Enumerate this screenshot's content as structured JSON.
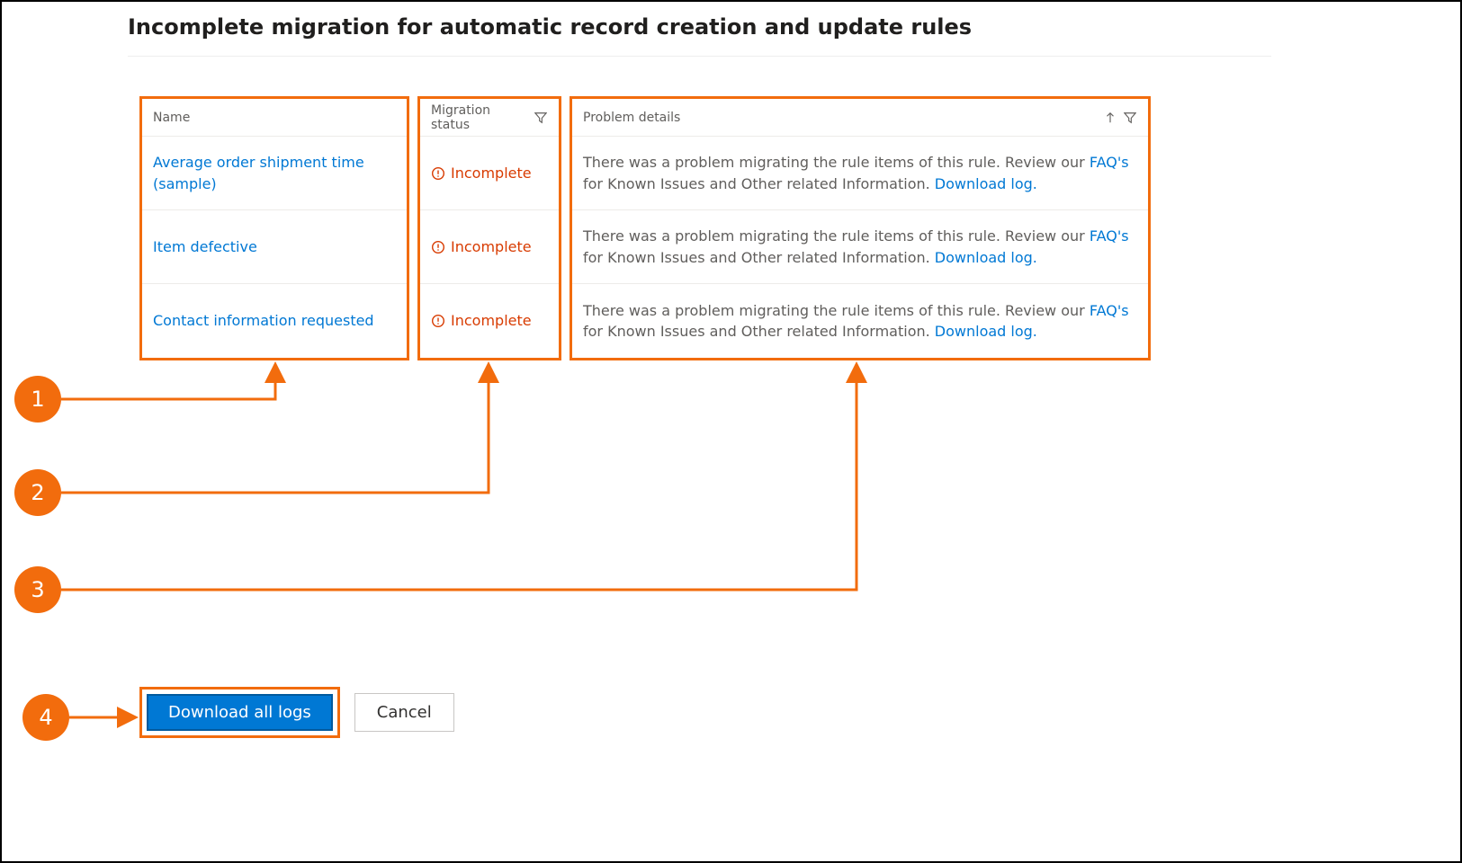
{
  "header": {
    "title": "Incomplete migration for automatic record creation and update rules"
  },
  "columns": {
    "name_label": "Name",
    "status_label": "Migration status",
    "detail_label": "Problem details"
  },
  "status_text": "Incomplete",
  "rows": [
    {
      "name": "Average order shipment time (sample)",
      "detail_prefix": "There was a problem migrating the rule items of this rule. Review our ",
      "faq_link": "FAQ's",
      "detail_mid": " for Known Issues and Other related Information. ",
      "download_link": "Download log."
    },
    {
      "name": "Item defective",
      "detail_prefix": "There was a problem migrating the rule items of this rule. Review our ",
      "faq_link": "FAQ's",
      "detail_mid": " for Known Issues and Other related Information. ",
      "download_link": "Download log."
    },
    {
      "name": "Contact information requested",
      "detail_prefix": "There was a problem migrating the rule items of this rule. Review our ",
      "faq_link": "FAQ's",
      "detail_mid": " for Known Issues and Other related Information. ",
      "download_link": "Download log."
    }
  ],
  "footer": {
    "download_all": "Download all logs",
    "cancel": "Cancel"
  },
  "callouts": [
    "1",
    "2",
    "3",
    "4"
  ]
}
